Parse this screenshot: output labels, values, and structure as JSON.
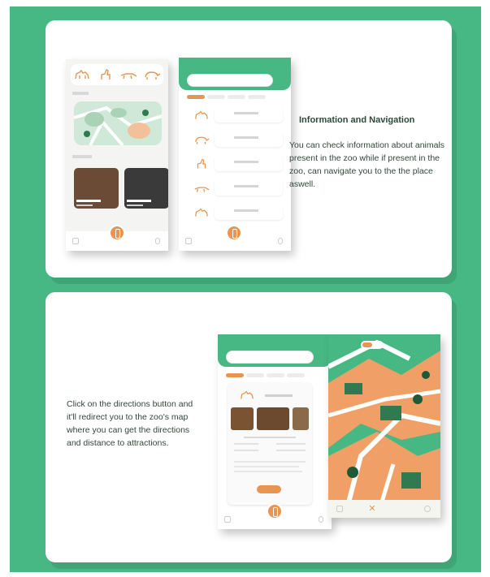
{
  "section1": {
    "heading": "Information and Navigation",
    "description": "You can check information about animals present in the zoo while if present in the zoo, can navigate you to the the place aswell."
  },
  "section2": {
    "description": "Click on the directions button and it'll redirect you to the zoo's map where you can get the directions and distance to attractions."
  },
  "colors": {
    "background_green": "#47b883",
    "accent_orange": "#e89552",
    "map_green": "#cfe8d8",
    "dark_green": "#1f6a3f"
  }
}
